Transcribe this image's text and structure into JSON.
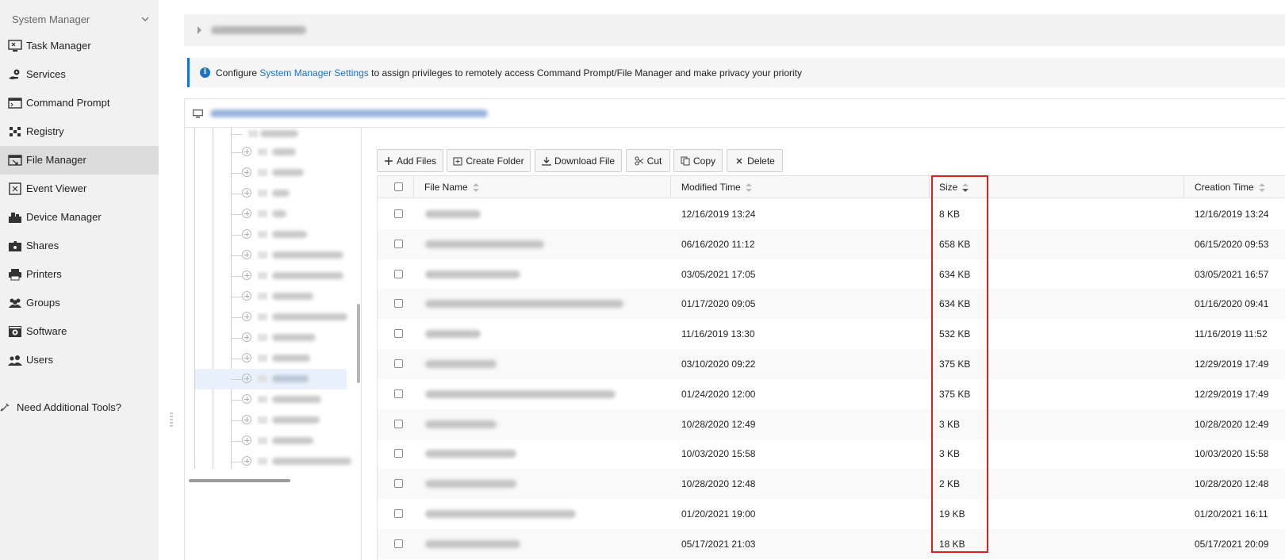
{
  "sidebar": {
    "header": "System Manager",
    "items": [
      {
        "label": "Task Manager",
        "icon": "task-manager-icon"
      },
      {
        "label": "Services",
        "icon": "services-icon"
      },
      {
        "label": "Command Prompt",
        "icon": "command-prompt-icon"
      },
      {
        "label": "Registry",
        "icon": "registry-icon"
      },
      {
        "label": "File Manager",
        "icon": "file-manager-icon",
        "active": true
      },
      {
        "label": "Event Viewer",
        "icon": "event-viewer-icon"
      },
      {
        "label": "Device Manager",
        "icon": "device-manager-icon"
      },
      {
        "label": "Shares",
        "icon": "shares-icon"
      },
      {
        "label": "Printers",
        "icon": "printer-icon"
      },
      {
        "label": "Groups",
        "icon": "groups-icon"
      },
      {
        "label": "Software",
        "icon": "software-icon"
      },
      {
        "label": "Users",
        "icon": "users-icon"
      }
    ],
    "extra": "Need Additional Tools?"
  },
  "info": {
    "before": "Configure ",
    "link": "System Manager Settings",
    "after": " to assign privileges to remotely access Command Prompt/File Manager and make privacy your priority"
  },
  "toolbar": {
    "add_files": "Add Files",
    "create_folder": "Create Folder",
    "download_file": "Download File",
    "cut": "Cut",
    "copy": "Copy",
    "delete": "Delete"
  },
  "table": {
    "columns": {
      "name": "File Name",
      "modified": "Modified Time",
      "size": "Size",
      "created": "Creation Time"
    },
    "rows": [
      {
        "modified": "12/16/2019 13:24",
        "size": "8 KB",
        "created": "12/16/2019 13:24"
      },
      {
        "modified": "06/16/2020 11:12",
        "size": "658 KB",
        "created": "06/15/2020 09:53"
      },
      {
        "modified": "03/05/2021 17:05",
        "size": "634 KB",
        "created": "03/05/2021 16:57"
      },
      {
        "modified": "01/17/2020 09:05",
        "size": "634 KB",
        "created": "01/16/2020 09:41"
      },
      {
        "modified": "11/16/2019 13:30",
        "size": "532 KB",
        "created": "11/16/2019 11:52"
      },
      {
        "modified": "03/10/2020 09:22",
        "size": "375 KB",
        "created": "12/29/2019 17:49"
      },
      {
        "modified": "01/24/2020 12:00",
        "size": "375 KB",
        "created": "12/29/2019 17:49"
      },
      {
        "modified": "10/28/2020 12:49",
        "size": "3 KB",
        "created": "10/28/2020 12:49"
      },
      {
        "modified": "10/03/2020 15:58",
        "size": "3 KB",
        "created": "10/03/2020 15:58"
      },
      {
        "modified": "10/28/2020 12:48",
        "size": "2 KB",
        "created": "10/28/2020 12:48"
      },
      {
        "modified": "01/20/2021 19:00",
        "size": "19 KB",
        "created": "01/20/2021 16:11"
      },
      {
        "modified": "05/17/2021 21:03",
        "size": "18 KB",
        "created": "05/17/2021 20:09"
      }
    ]
  },
  "colors": {
    "accent": "#1a73c9",
    "highlight": "#e0201f",
    "sidebar_bg": "#f1f1f1",
    "sidebar_active": "#dcdcdc"
  }
}
